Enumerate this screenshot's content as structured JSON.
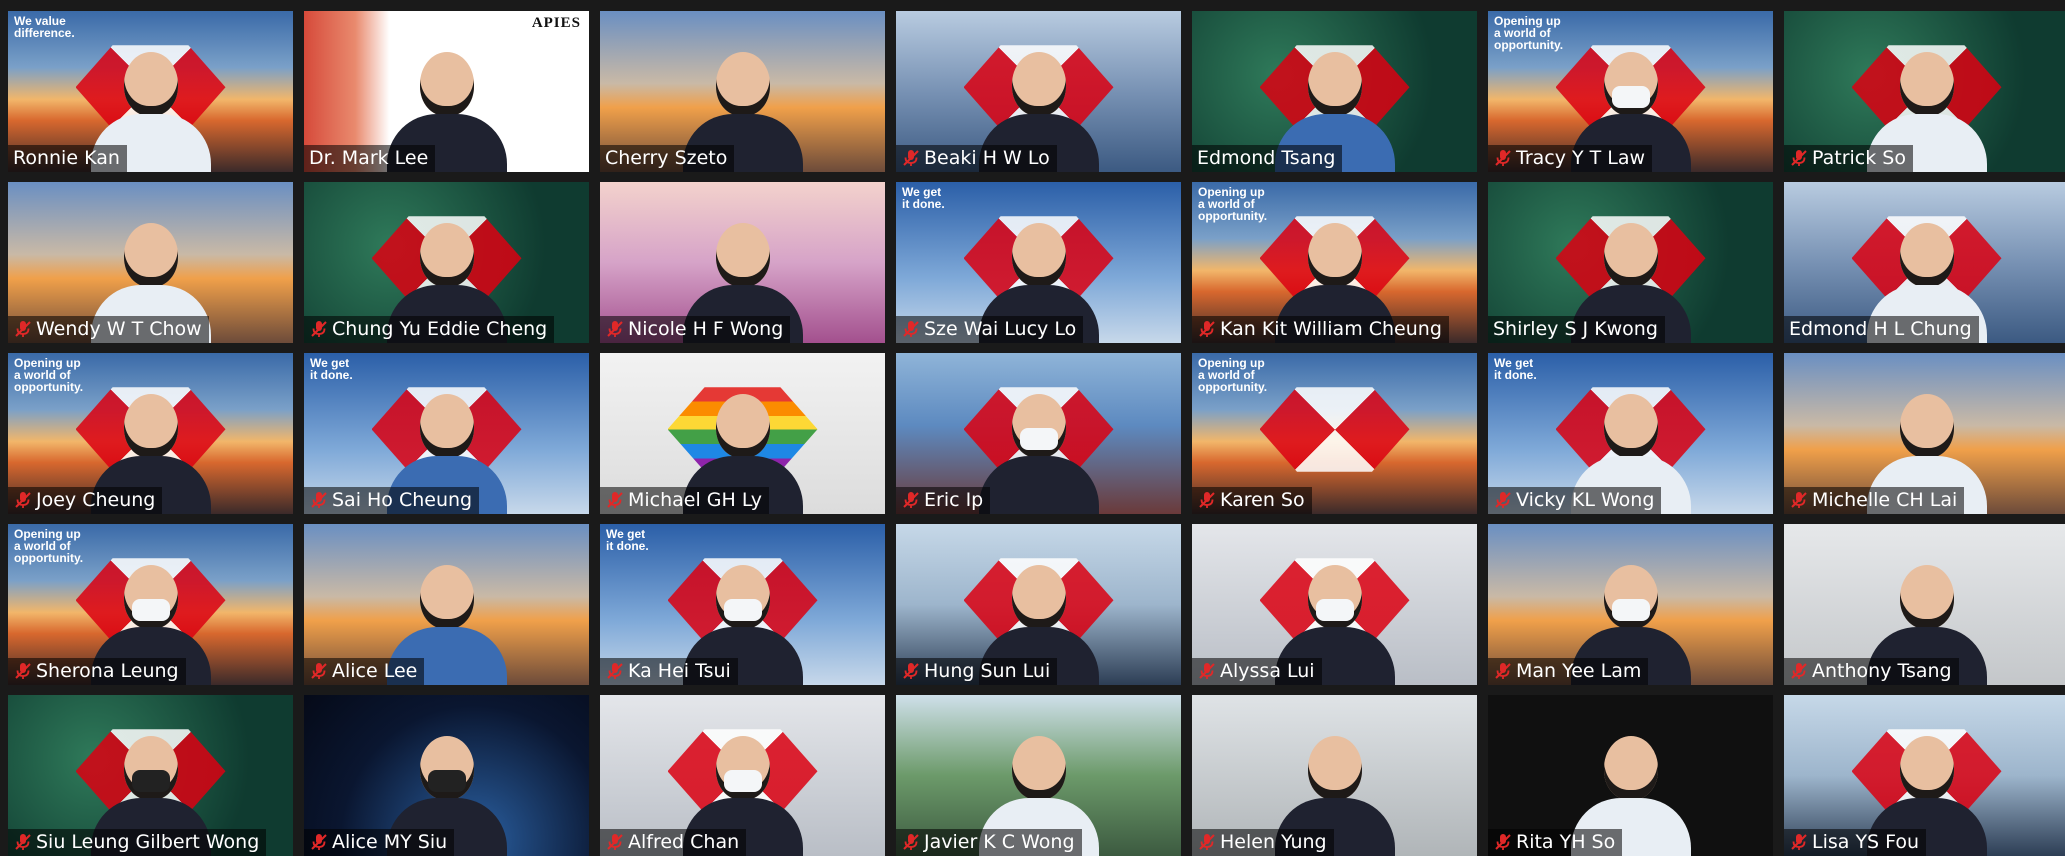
{
  "app": "Zoom meeting gallery view",
  "active_speaker_color": "#c8e63c",
  "mute_icon_color": "#e02828",
  "participants": [
    {
      "name": "Ronnie Kan",
      "muted": false,
      "active": true,
      "bg": "sunset",
      "slogan": "We value\ndifference.",
      "hex": true,
      "style": "light"
    },
    {
      "name": "Dr. Mark Lee",
      "muted": false,
      "bg": "white",
      "logo": "APIES",
      "style": ""
    },
    {
      "name": "Cherry Szeto",
      "muted": false,
      "bg": "bridge",
      "style": ""
    },
    {
      "name": "Beaki H W Lo",
      "muted": true,
      "bg": "city",
      "hex": true,
      "style": ""
    },
    {
      "name": "Edmond Tsang",
      "muted": false,
      "bg": "forest",
      "hex": true,
      "style": "blue"
    },
    {
      "name": "Tracy Y T Law",
      "muted": true,
      "bg": "sunset",
      "slogan": "Opening up\na world of\nopportunity.",
      "hex": true,
      "style": "mask"
    },
    {
      "name": "Patrick So",
      "muted": true,
      "bg": "forest",
      "hex": true,
      "style": "light"
    },
    {
      "name": "Wendy W T Chow",
      "muted": true,
      "bg": "bridge",
      "style": "light"
    },
    {
      "name": "Chung Yu Eddie Cheng",
      "muted": true,
      "bg": "forest",
      "hex": true,
      "style": ""
    },
    {
      "name": "Nicole H F Wong",
      "muted": true,
      "bg": "lav",
      "style": ""
    },
    {
      "name": "Sze Wai Lucy Lo",
      "muted": true,
      "bg": "sky",
      "slogan": "We get\nit done.",
      "hex": true,
      "style": ""
    },
    {
      "name": "Kan Kit William Cheung",
      "muted": true,
      "bg": "sunset",
      "slogan": "Opening up\na world of\nopportunity.",
      "hex": true,
      "style": ""
    },
    {
      "name": "Shirley S J Kwong",
      "muted": false,
      "bg": "forest",
      "hex": true,
      "style": ""
    },
    {
      "name": "Edmond H L Chung",
      "muted": false,
      "bg": "city",
      "hex": true,
      "style": "light"
    },
    {
      "name": "Joey Cheung",
      "muted": true,
      "bg": "sunset",
      "slogan": "Opening up\na world of\nopportunity.",
      "hex": true,
      "style": ""
    },
    {
      "name": "Sai Ho Cheung",
      "muted": true,
      "bg": "sky",
      "slogan": "We get\nit done.",
      "hex": true,
      "style": "blue"
    },
    {
      "name": "Michael GH Ly",
      "muted": true,
      "bg": "rainbow",
      "rainbow": true,
      "style": ""
    },
    {
      "name": "Eric Ip",
      "muted": true,
      "bg": "cont",
      "hex": true,
      "style": "mask"
    },
    {
      "name": "Karen So",
      "muted": true,
      "bg": "sunset",
      "slogan": "Opening up\na world of\nopportunity.",
      "hex": true,
      "empty": true
    },
    {
      "name": "Vicky KL Wong",
      "muted": true,
      "bg": "sky",
      "slogan": "We get\nit done.",
      "hex": true,
      "style": "light"
    },
    {
      "name": "Michelle CH Lai",
      "muted": true,
      "bg": "bridge",
      "style": "light"
    },
    {
      "name": "Sherona Leung",
      "muted": true,
      "bg": "sunset",
      "slogan": "Opening up\na world of\nopportunity.",
      "hex": true,
      "style": "mask"
    },
    {
      "name": "Alice Lee",
      "muted": true,
      "bg": "bridge",
      "style": "blue"
    },
    {
      "name": "Ka Hei Tsui",
      "muted": true,
      "bg": "sky",
      "slogan": "We get\nit done.",
      "hex": true,
      "style": "mask"
    },
    {
      "name": "Hung Sun Lui",
      "muted": true,
      "bg": "solar",
      "hex": true,
      "style": ""
    },
    {
      "name": "Alyssa Lui",
      "muted": true,
      "bg": "grey",
      "hex": true,
      "style": "mask"
    },
    {
      "name": "Man Yee Lam",
      "muted": true,
      "bg": "bridge",
      "style": "mask"
    },
    {
      "name": "Anthony Tsang",
      "muted": true,
      "bg": "office",
      "style": ""
    },
    {
      "name": "Siu Leung Gilbert Wong",
      "muted": true,
      "bg": "forest",
      "hex": true,
      "style": "blackmask"
    },
    {
      "name": "Alice MY Siu",
      "muted": true,
      "bg": "space",
      "style": "blackmask"
    },
    {
      "name": "Alfred Chan",
      "muted": true,
      "bg": "grey",
      "hex": true,
      "style": "mask"
    },
    {
      "name": "Javier K C Wong",
      "muted": true,
      "bg": "plant",
      "style": "light"
    },
    {
      "name": "Helen Yung",
      "muted": true,
      "bg": "room",
      "style": ""
    },
    {
      "name": "Rita YH So",
      "muted": true,
      "bg": "black",
      "style": "light"
    },
    {
      "name": "Lisa YS Fou",
      "muted": true,
      "bg": "solar",
      "hex": true,
      "style": ""
    }
  ]
}
